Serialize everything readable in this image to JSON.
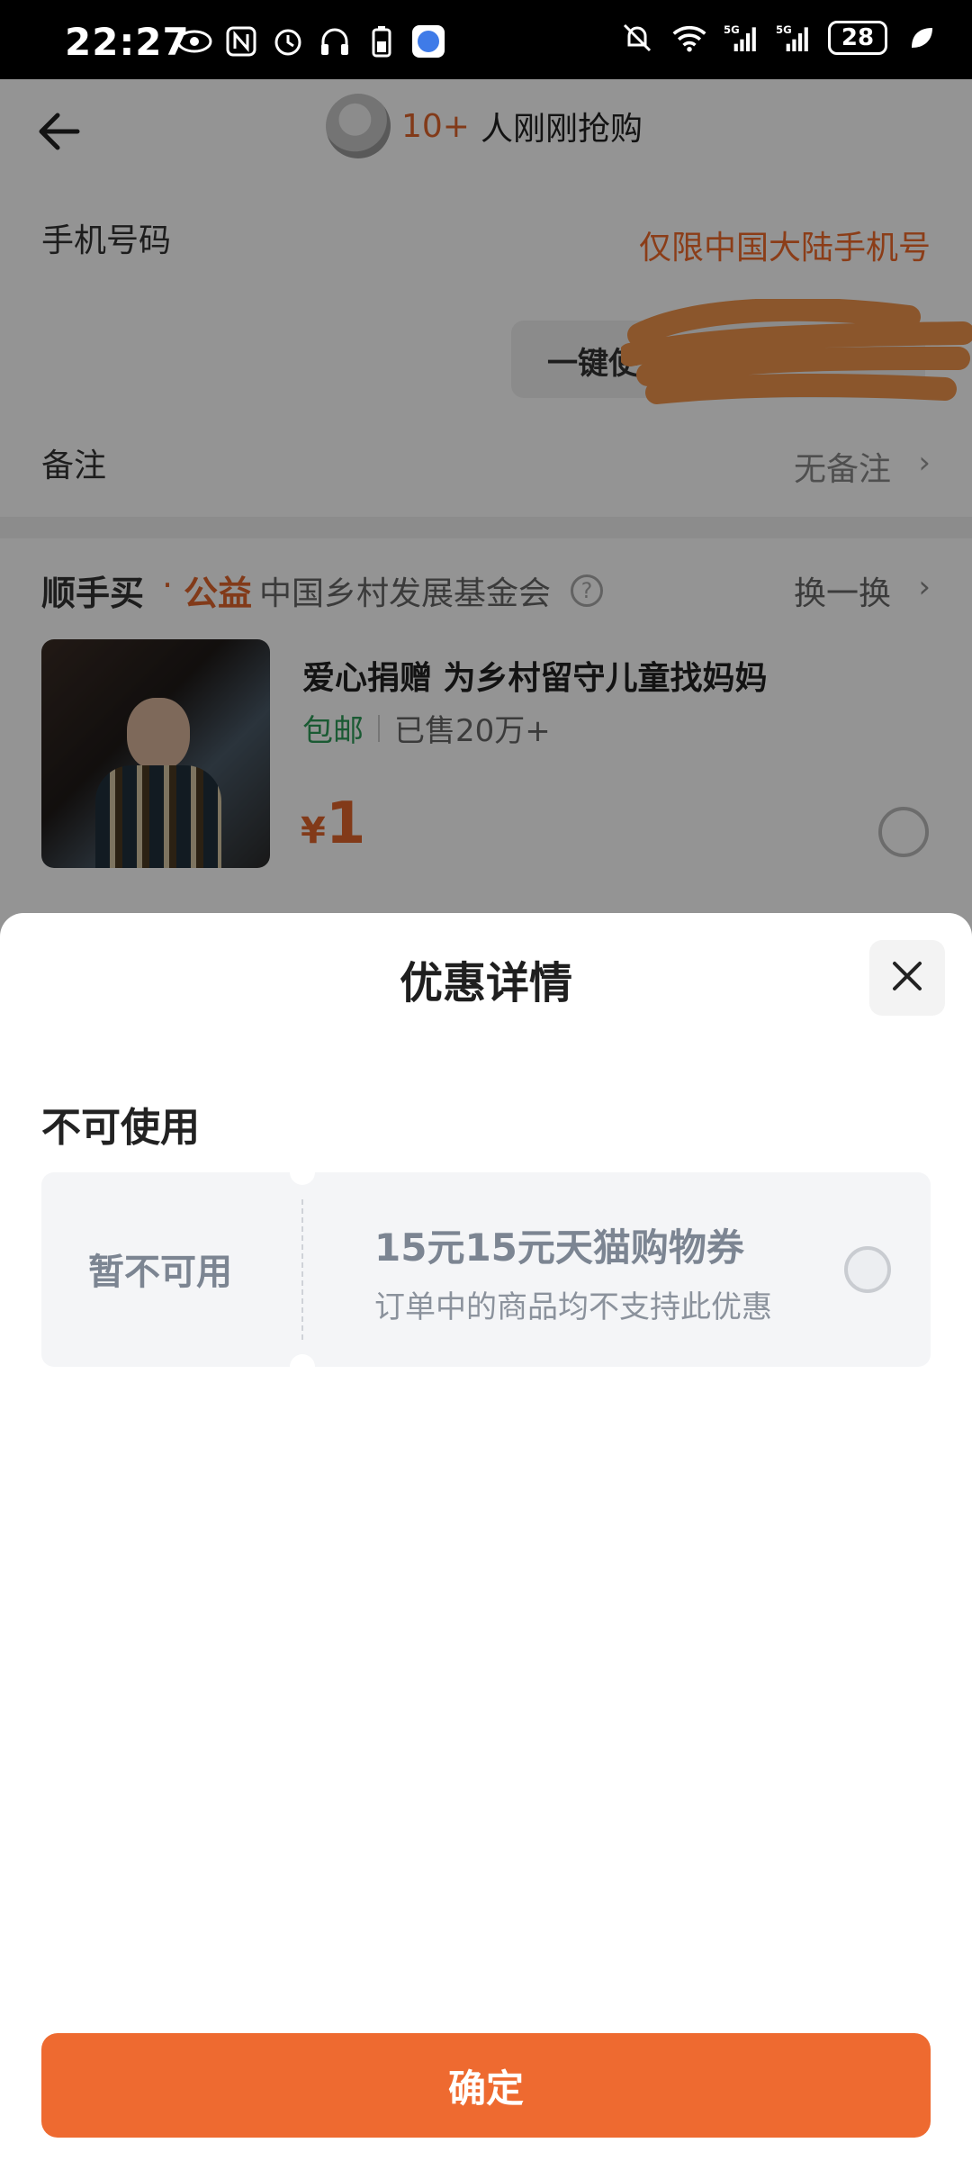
{
  "status_bar": {
    "time": "22:27",
    "battery": "28",
    "left_icons": [
      "eye-icon",
      "nfc-icon",
      "alarm-icon",
      "headphones-icon",
      "battery-saver-icon",
      "app-icon"
    ],
    "right_icons": [
      "mute-icon",
      "wifi-icon",
      "signal-5g-icon",
      "signal-5g-icon",
      "leaf-icon"
    ]
  },
  "top_bar": {
    "buyer_count": "10+",
    "buyer_text": "人刚刚抢购"
  },
  "phone": {
    "label": "手机号码",
    "hint": "仅限中国大陆手机号",
    "one_click_label": "一键使用"
  },
  "remark": {
    "label": "备注",
    "value": "无备注"
  },
  "charity": {
    "brand": "顺手买",
    "dot": "·",
    "tag": "公益",
    "org": "中国乡村发展基金会",
    "swap": "换一换",
    "help": "?"
  },
  "product": {
    "title": "爱心捐赠 为乡村留守儿童找妈妈",
    "shipping": "包邮",
    "sold": "已售20万+",
    "currency": "¥",
    "price": "1"
  },
  "sheet": {
    "title": "优惠详情",
    "section_title": "不可使用",
    "coupon": {
      "status": "暂不可用",
      "name": "15元15元天猫购物券",
      "desc": "订单中的商品均不支持此优惠"
    },
    "confirm_label": "确定"
  },
  "colors": {
    "accent": "#ee6a30",
    "price": "#e0652b",
    "shipping_green": "#2d9b58",
    "coupon_bg": "#f4f5f7"
  }
}
